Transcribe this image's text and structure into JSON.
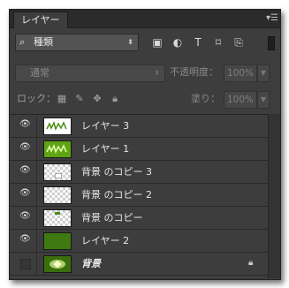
{
  "panel": {
    "tab_label": "レイヤー",
    "menu_icon": "panel-menu-icon"
  },
  "filter": {
    "kind_label": "種類",
    "icons": [
      "image-filter-icon",
      "adjustment-filter-icon",
      "type-filter-icon",
      "shape-filter-icon",
      "smart-object-filter-icon"
    ],
    "icon_glyphs": [
      "▣",
      "◐",
      "T",
      "⌑",
      "⎘"
    ]
  },
  "blend": {
    "mode": "通常",
    "opacity_label": "不透明度：",
    "opacity_value": "100%",
    "fill_label": "塗り：",
    "fill_value": "100%"
  },
  "lock": {
    "label": "ロック："
  },
  "layers": [
    {
      "name": "レイヤー 3",
      "thumb": "text-white",
      "visible": true,
      "selected": false
    },
    {
      "name": "レイヤー 1",
      "thumb": "text-green",
      "visible": true,
      "selected": false
    },
    {
      "name": "背景 のコピー 3",
      "thumb": "checker-white",
      "visible": true,
      "selected": false
    },
    {
      "name": "背景 のコピー 2",
      "thumb": "checker",
      "visible": true,
      "selected": false
    },
    {
      "name": "背景 のコピー",
      "thumb": "checker-green",
      "visible": true,
      "selected": false
    },
    {
      "name": "レイヤー 2",
      "thumb": "solid-green",
      "visible": true,
      "selected": false
    },
    {
      "name": "背景",
      "thumb": "background",
      "visible": false,
      "selected": false,
      "locked": true
    }
  ]
}
